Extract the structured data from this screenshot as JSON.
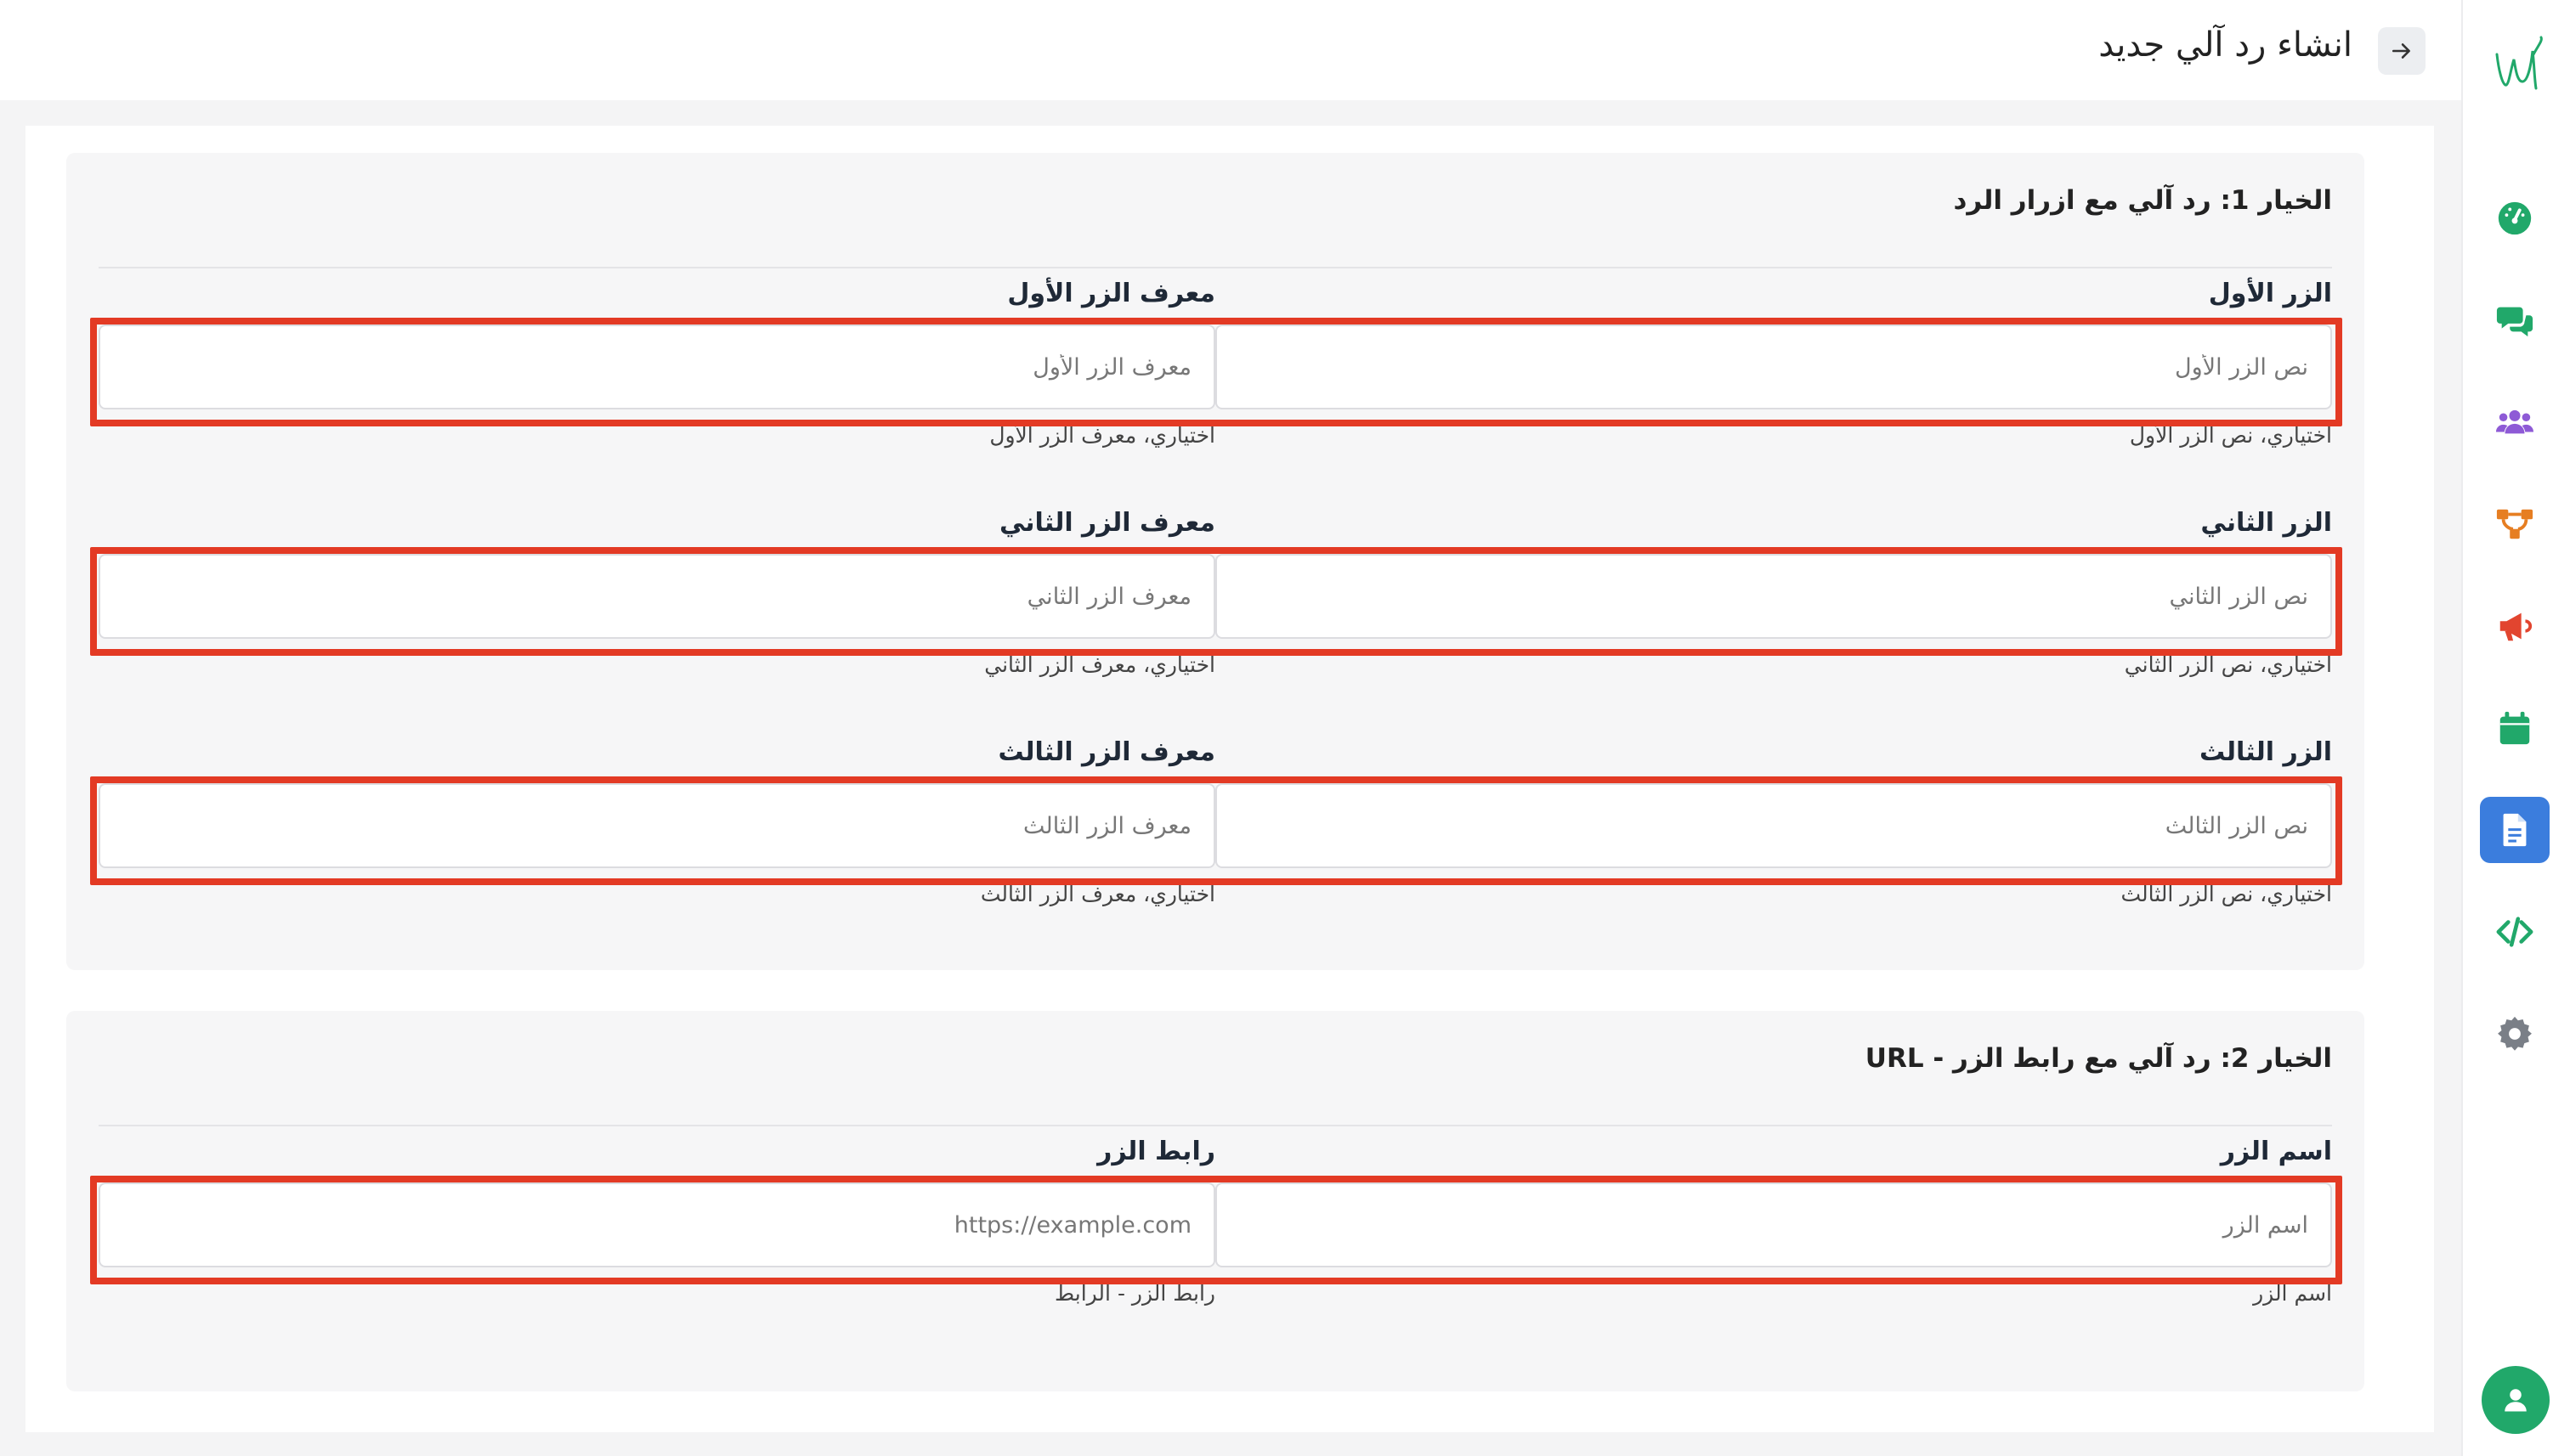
{
  "header": {
    "title": "انشاء رد آلي جديد"
  },
  "option1": {
    "title": "الخيار 1: رد آلي مع ازرار الرد",
    "rows": [
      {
        "text_label": "الزر الأول",
        "text_placeholder": "نص الزر الأول",
        "text_hint": "اختياري، نص الزر الأول",
        "id_label": "معرف الزر الأول",
        "id_placeholder": "معرف الزر الأول",
        "id_hint": "اختياري، معرف الزر الأول"
      },
      {
        "text_label": "الزر الثاني",
        "text_placeholder": "نص الزر الثاني",
        "text_hint": "اختياري، نص الزر الثاني",
        "id_label": "معرف الزر الثاني",
        "id_placeholder": "معرف الزر الثاني",
        "id_hint": "اختياري، معرف الزر الثاني"
      },
      {
        "text_label": "الزر الثالث",
        "text_placeholder": "نص الزر الثالث",
        "text_hint": "اختياري، نص الزر الثالث",
        "id_label": "معرف الزر الثالث",
        "id_placeholder": "معرف الزر الثالث",
        "id_hint": "اختياري، معرف الزر الثالث"
      }
    ]
  },
  "option2": {
    "title": "الخيار 2: رد آلي مع رابط الزر - URL",
    "name_label": "اسم الزر",
    "name_placeholder": "اسم الزر",
    "name_hint": "اسم الزر",
    "url_label": "رابط الزر",
    "url_placeholder": "https://example.com",
    "url_hint": "رابط الزر - الرابط"
  },
  "sidebar": {
    "items": [
      {
        "icon": "dashboard-gauge-icon",
        "color": "#21a86a"
      },
      {
        "icon": "chat-bubbles-icon",
        "color": "#21a86a"
      },
      {
        "icon": "users-group-icon",
        "color": "#8e5ad6"
      },
      {
        "icon": "flow-sitemap-icon",
        "color": "#e67e22"
      },
      {
        "icon": "megaphone-icon",
        "color": "#e2452f"
      },
      {
        "icon": "calendar-icon",
        "color": "#21a86a"
      },
      {
        "icon": "document-icon",
        "color": "#3b7ddd",
        "active": true
      },
      {
        "icon": "code-icon",
        "color": "#21a86a"
      },
      {
        "icon": "gear-icon",
        "color": "#7a7f87"
      }
    ]
  },
  "colors": {
    "accent_active": "#3b7ddd",
    "highlight": "#e33a24",
    "brand_green": "#21a86a"
  }
}
